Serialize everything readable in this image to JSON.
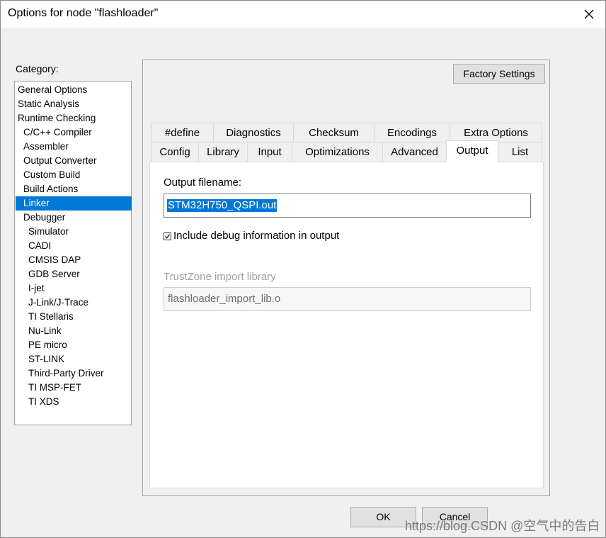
{
  "window": {
    "title": "Options for node \"flashloader\""
  },
  "category": {
    "label": "Category:",
    "items": [
      {
        "label": "General Options",
        "level": 0
      },
      {
        "label": "Static Analysis",
        "level": 0
      },
      {
        "label": "Runtime Checking",
        "level": 0
      },
      {
        "label": "C/C++ Compiler",
        "level": 1
      },
      {
        "label": "Assembler",
        "level": 1
      },
      {
        "label": "Output Converter",
        "level": 1
      },
      {
        "label": "Custom Build",
        "level": 1
      },
      {
        "label": "Build Actions",
        "level": 1
      },
      {
        "label": "Linker",
        "level": 1,
        "selected": true
      },
      {
        "label": "Debugger",
        "level": 1
      },
      {
        "label": "Simulator",
        "level": 2
      },
      {
        "label": "CADI",
        "level": 2
      },
      {
        "label": "CMSIS DAP",
        "level": 2
      },
      {
        "label": "GDB Server",
        "level": 2
      },
      {
        "label": "I-jet",
        "level": 2
      },
      {
        "label": "J-Link/J-Trace",
        "level": 2
      },
      {
        "label": "TI Stellaris",
        "level": 2
      },
      {
        "label": "Nu-Link",
        "level": 2
      },
      {
        "label": "PE micro",
        "level": 2
      },
      {
        "label": "ST-LINK",
        "level": 2
      },
      {
        "label": "Third-Party Driver",
        "level": 2
      },
      {
        "label": "TI MSP-FET",
        "level": 2
      },
      {
        "label": "TI XDS",
        "level": 2
      }
    ]
  },
  "factory_settings": "Factory Settings",
  "tabs": {
    "row1": [
      "#define",
      "Diagnostics",
      "Checksum",
      "Encodings",
      "Extra Options"
    ],
    "row2": [
      "Config",
      "Library",
      "Input",
      "Optimizations",
      "Advanced",
      "Output",
      "List"
    ],
    "active": "Output"
  },
  "output": {
    "filename_label": "Output filename:",
    "filename_value": "STM32H750_QSPI.out",
    "debug_checkbox_label": "Include debug information in output",
    "debug_checked": true,
    "trustzone_label": "TrustZone import library",
    "trustzone_value": "flashloader_import_lib.o"
  },
  "buttons": {
    "ok": "OK",
    "cancel": "Cancel"
  },
  "watermark": "https://blog.CSDN @空气中的告白"
}
